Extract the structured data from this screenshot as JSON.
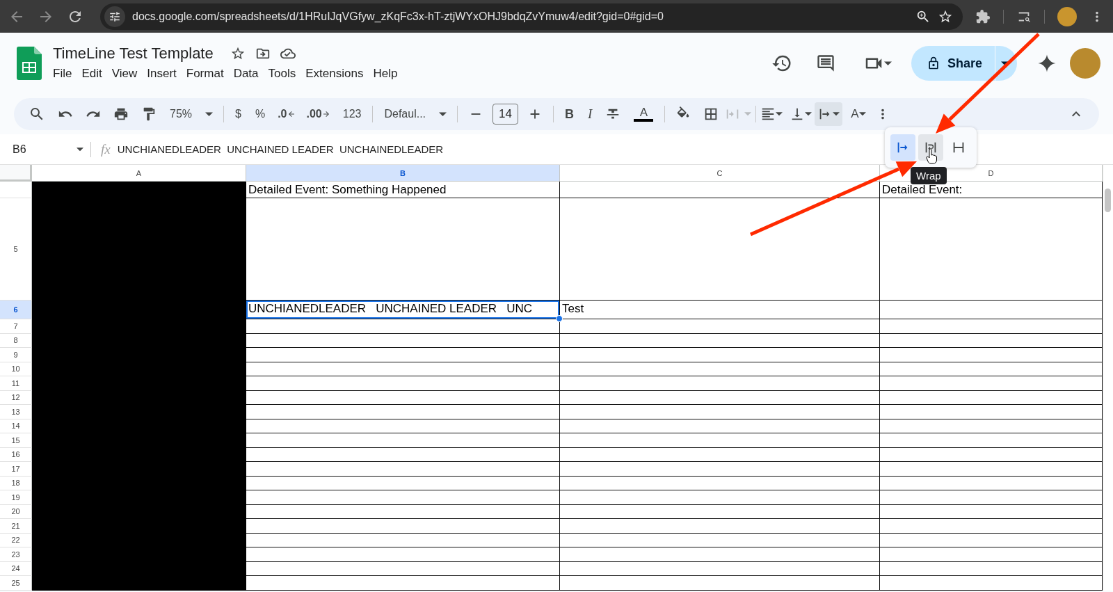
{
  "browser": {
    "url": "docs.google.com/spreadsheets/d/1HRuIJqVGfyw_zKqFc3x-hT-ztjWYxOHJ9bdqZvYmuw4/edit?gid=0#gid=0"
  },
  "document": {
    "title": "TimeLine Test Template",
    "menu": [
      "File",
      "Edit",
      "View",
      "Insert",
      "Format",
      "Data",
      "Tools",
      "Extensions",
      "Help"
    ]
  },
  "share_button": {
    "label": "Share"
  },
  "toolbar": {
    "zoom": "75%",
    "currency": "$",
    "percent": "%",
    "decrease_decimals": ".0",
    "increase_decimals": ".00",
    "more_formats": "123",
    "font": "Defaul...",
    "font_size": "14",
    "bold": "B",
    "italic": "I",
    "text_color": "A",
    "text_rotation": "A",
    "merge_disabled": true,
    "wrap_menu_open": true
  },
  "wrap_menu": {
    "options": [
      {
        "kind": "overflow",
        "selected": true,
        "hovered": false
      },
      {
        "kind": "wrap",
        "selected": false,
        "hovered": true
      },
      {
        "kind": "clip",
        "selected": false,
        "hovered": false
      }
    ],
    "tooltip": "Wrap"
  },
  "formula_bar": {
    "cell": "B6",
    "function_label": "fx",
    "formula": "UNCHIANEDLEADER  UNCHAINED LEADER  UNCHAINEDLEADER"
  },
  "grid": {
    "columns": [
      {
        "label": "A",
        "selected": false,
        "filled": true
      },
      {
        "label": "B",
        "selected": true,
        "filled": false
      },
      {
        "label": "C",
        "selected": false,
        "filled": false
      },
      {
        "label": "D",
        "selected": false,
        "filled": false
      }
    ],
    "rows": [
      {
        "selected": false,
        "cells": {
          "b": {
            "text": "Detailed Event: Something Happened",
            "selected": false
          },
          "d": {
            "text": "Detailed Event:",
            "selected": false
          }
        }
      },
      {
        "number": "5",
        "selected": false
      },
      {
        "number": "6",
        "selected": true,
        "cells": {
          "b": {
            "text": "UNCHIANEDLEADER   UNCHAINED LEADER   UNC",
            "selected": true
          },
          "c": {
            "text": "Test",
            "selected": false
          }
        }
      },
      {
        "number": "7",
        "selected": false
      },
      {
        "number": "8",
        "selected": false
      },
      {
        "number": "9",
        "selected": false
      },
      {
        "number": "10",
        "selected": false
      },
      {
        "number": "11",
        "selected": false
      },
      {
        "number": "12",
        "selected": false
      },
      {
        "number": "13",
        "selected": false
      },
      {
        "number": "14",
        "selected": false
      },
      {
        "number": "15",
        "selected": false
      },
      {
        "number": "16",
        "selected": false
      },
      {
        "number": "17",
        "selected": false
      },
      {
        "number": "18",
        "selected": false
      },
      {
        "number": "19",
        "selected": false
      },
      {
        "number": "20",
        "selected": false
      },
      {
        "number": "21",
        "selected": false
      },
      {
        "number": "22",
        "selected": false
      },
      {
        "number": "23",
        "selected": false
      },
      {
        "number": "24",
        "selected": false
      },
      {
        "number": "25",
        "selected": false
      }
    ]
  }
}
